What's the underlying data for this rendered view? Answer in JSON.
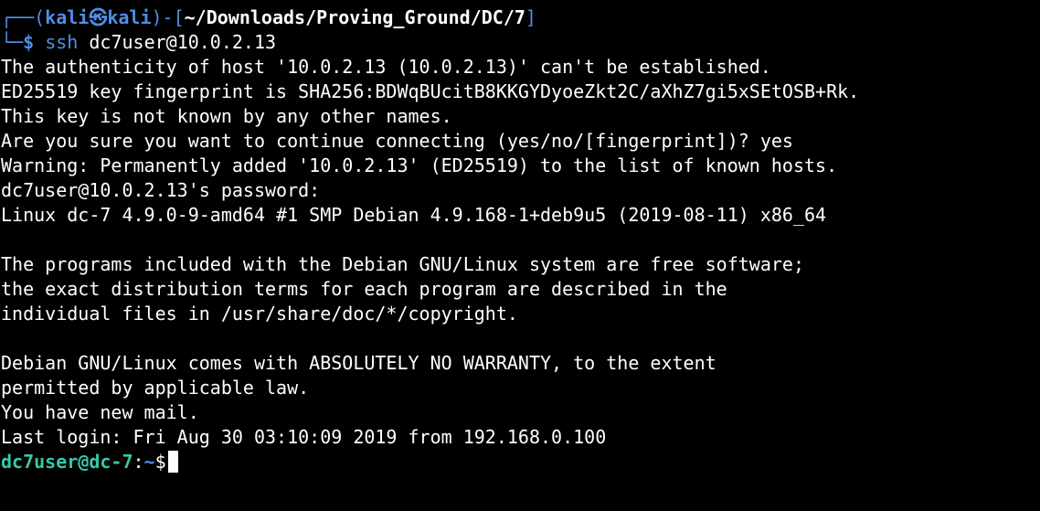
{
  "colors": {
    "background": "#000000",
    "text": "#ffffff",
    "prompt_frame": "#4f8ee8",
    "prompt_user": "#4f8ee8",
    "remote_prompt": "#36c9a6"
  },
  "local_prompt": {
    "frame_top": "┌──(",
    "user": "kali",
    "at_icon": "㉿",
    "host": "kali",
    "frame_mid": ")-[",
    "path": "~/Downloads/Proving_Ground/DC/7",
    "frame_close": "]",
    "frame_bottom": "└─",
    "dollar": "$",
    "command": "ssh",
    "argument": "dc7user@10.0.2.13"
  },
  "output_lines": [
    "The authenticity of host '10.0.2.13 (10.0.2.13)' can't be established.",
    "ED25519 key fingerprint is SHA256:BDWqBUcitB8KKGYDyoeZkt2C/aXhZ7gi5xSEtOSB+Rk.",
    "This key is not known by any other names.",
    "Are you sure you want to continue connecting (yes/no/[fingerprint])? yes",
    "Warning: Permanently added '10.0.2.13' (ED25519) to the list of known hosts.",
    "dc7user@10.0.2.13's password:",
    "Linux dc-7 4.9.0-9-amd64 #1 SMP Debian 4.9.168-1+deb9u5 (2019-08-11) x86_64",
    "",
    "The programs included with the Debian GNU/Linux system are free software;",
    "the exact distribution terms for each program are described in the",
    "individual files in /usr/share/doc/*/copyright.",
    "",
    "Debian GNU/Linux comes with ABSOLUTELY NO WARRANTY, to the extent",
    "permitted by applicable law.",
    "You have new mail.",
    "Last login: Fri Aug 30 03:10:09 2019 from 192.168.0.100"
  ],
  "remote_prompt": {
    "user_host": "dc7user@dc-7",
    "colon": ":",
    "path": "~",
    "dollar": "$"
  }
}
